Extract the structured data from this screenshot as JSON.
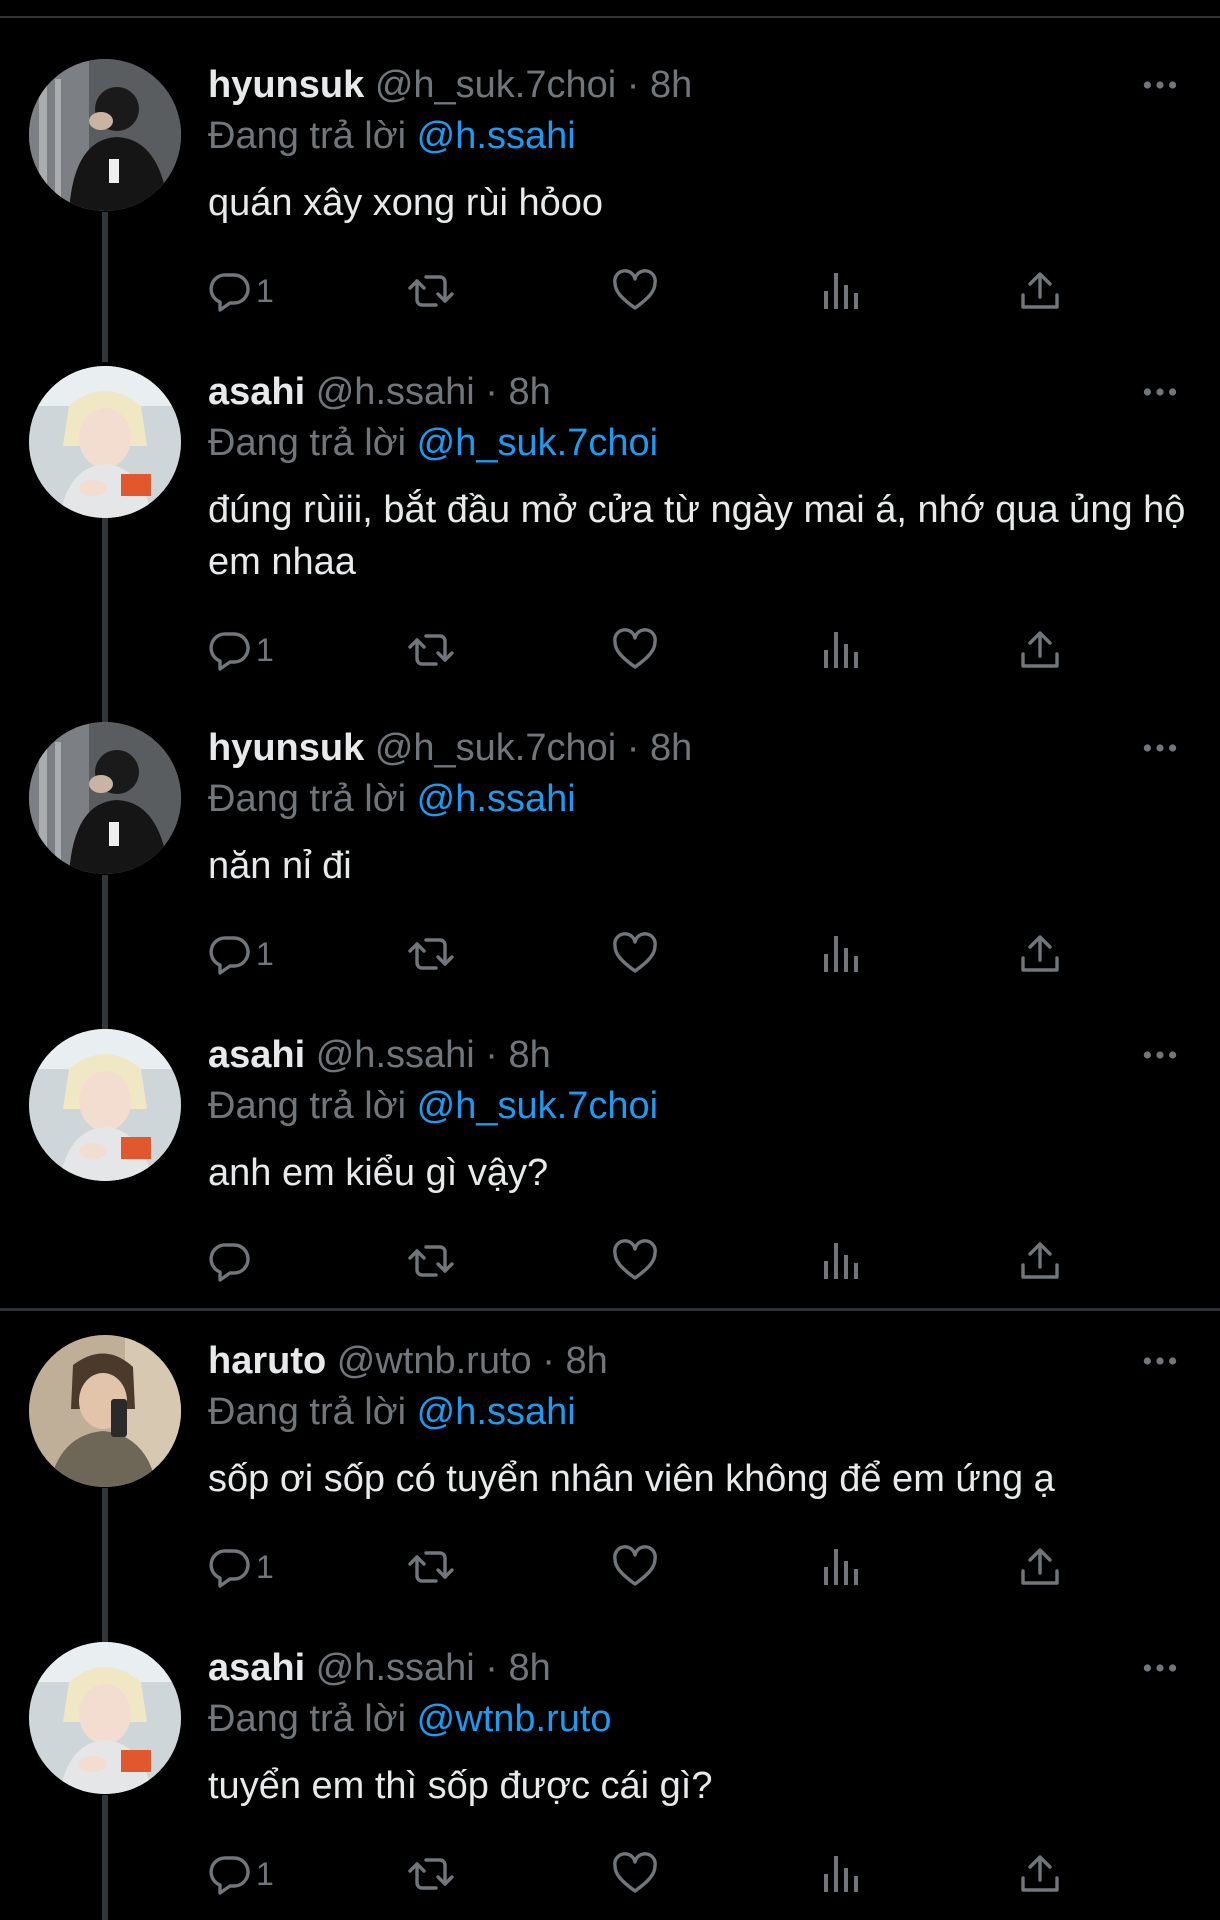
{
  "tweets": [
    {
      "name": "hyunsuk",
      "handle": "@h_suk.7choi",
      "dot": "·",
      "time": "8h",
      "reply_prefix": "Đang trả lời",
      "reply_to": "@h.ssahi",
      "text": "quán xây xong rùi hỏoo",
      "reply_count": "1",
      "avatar_icon": "avatar-hyunsuk"
    },
    {
      "name": "asahi",
      "handle": "@h.ssahi",
      "dot": "·",
      "time": "8h",
      "reply_prefix": "Đang trả lời",
      "reply_to": "@h_suk.7choi",
      "text": "đúng rùiii, bắt đầu mở cửa từ ngày mai á, nhớ qua ủng hộ em nhaa",
      "reply_count": "1",
      "avatar_icon": "avatar-asahi"
    },
    {
      "name": "hyunsuk",
      "handle": "@h_suk.7choi",
      "dot": "·",
      "time": "8h",
      "reply_prefix": "Đang trả lời",
      "reply_to": "@h.ssahi",
      "text": "năn nỉ đi",
      "reply_count": "1",
      "avatar_icon": "avatar-hyunsuk"
    },
    {
      "name": "asahi",
      "handle": "@h.ssahi",
      "dot": "·",
      "time": "8h",
      "reply_prefix": "Đang trả lời",
      "reply_to": "@h_suk.7choi",
      "text": "anh em kiểu gì vậy?",
      "reply_count": "",
      "avatar_icon": "avatar-asahi"
    },
    {
      "name": "haruto",
      "handle": "@wtnb.ruto",
      "dot": "·",
      "time": "8h",
      "reply_prefix": "Đang trả lời",
      "reply_to": "@h.ssahi",
      "text": "sốp ơi sốp có tuyển nhân viên không để em ứng ạ",
      "reply_count": "1",
      "avatar_icon": "avatar-haruto"
    },
    {
      "name": "asahi",
      "handle": "@h.ssahi",
      "dot": "·",
      "time": "8h",
      "reply_prefix": "Đang trả lời",
      "reply_to": "@wtnb.ruto",
      "text": "tuyển em thì sốp được cái gì?",
      "reply_count": "1",
      "avatar_icon": "avatar-asahi"
    }
  ],
  "icons": {
    "more": "more-horizontal-icon",
    "reply": "reply-bubble-icon",
    "retweet": "retweet-icon",
    "like": "heart-icon",
    "views": "views-bar-chart-icon",
    "share": "share-upload-icon"
  },
  "colors": {
    "background": "#000000",
    "text": "#e7e9ea",
    "muted": "#71767b",
    "link": "#1d9bf0",
    "divider": "#2f3336"
  }
}
